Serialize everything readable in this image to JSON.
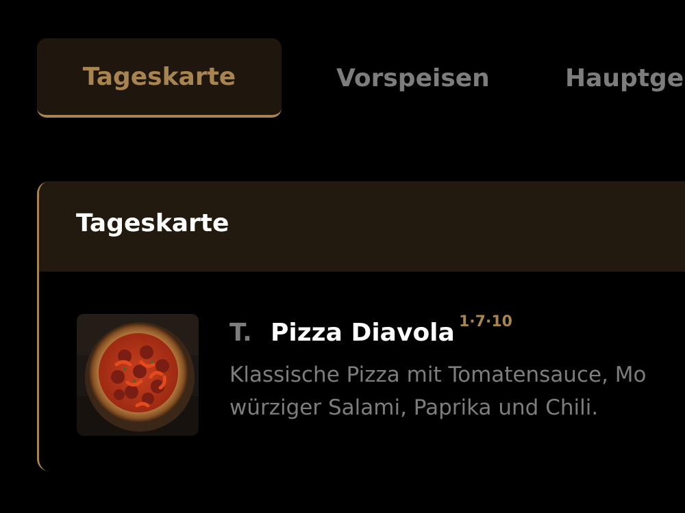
{
  "tabs": [
    {
      "label": "Tageskarte",
      "active": true
    },
    {
      "label": "Vorspeisen",
      "active": false
    },
    {
      "label": "Hauptge",
      "active": false
    }
  ],
  "section": {
    "title": "Tageskarte",
    "items": [
      {
        "code": "T.",
        "name": "Pizza Diavola",
        "allergens": "1·7·10",
        "description_lines": [
          "Klassische Pizza mit Tomatensauce, Mo",
          "würziger Salami, Paprika und Chili."
        ],
        "image_icon": "pizza-image"
      }
    ]
  },
  "colors": {
    "background": "#000000",
    "accent_gold": "#a78450",
    "active_tab_bg": "#1f170d",
    "section_header_bg": "#221a0f",
    "muted_text": "#7d7d7d",
    "primary_text": "#ffffff"
  }
}
